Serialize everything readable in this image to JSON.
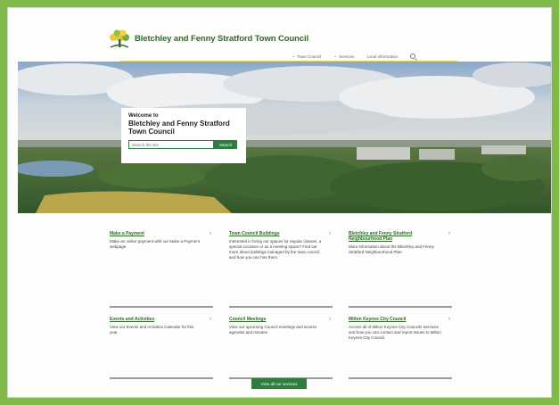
{
  "header": {
    "site_name": "Bletchley and Fenny Stratford Town Council",
    "logo_icon": "tree-logo-icon",
    "nav": [
      {
        "label": "Town Council",
        "icon": "chevron-down-icon"
      },
      {
        "label": "Services",
        "icon": "chevron-down-icon"
      },
      {
        "label": "Local Information",
        "icon": ""
      }
    ],
    "search_icon": "search-icon"
  },
  "hero": {
    "welcome_small": "Welcome to",
    "welcome_title": "Bletchley and Fenny Stratford Town Council",
    "search_placeholder": "Search the site",
    "search_button": "Search"
  },
  "cards": [
    {
      "title": "Make a Payment",
      "body": "Make an online payment with our Make a Payment webpage"
    },
    {
      "title": "Town Council Buildings",
      "body": "Interested in hiring our spaces for regular classes, a special occasion or as a meeting space? Find out more about buildings managed by the town council and how you can hire them."
    },
    {
      "title": "Bletchley and Fenny Stratford Neighbourhood Plan",
      "body": "More information about the Bletchley and Fenny Stratford Neighbourhood Plan."
    },
    {
      "title": "Events and Activities",
      "body": "View our Events and Activities Calendar for this year"
    },
    {
      "title": "Council Meetings",
      "body": "View our upcoming Council meetings and access agendas and minutes"
    },
    {
      "title": "Milton Keynes City Council",
      "body": "Access all of Milton Keynes City Councils Services and how you can contact and report issues to Milton Keynes City Council."
    }
  ],
  "view_button": "View all our services",
  "colors": {
    "primary_green": "#2e7d3f",
    "accent_yellow": "#e7d85a",
    "frame_green": "#7fb94a"
  }
}
